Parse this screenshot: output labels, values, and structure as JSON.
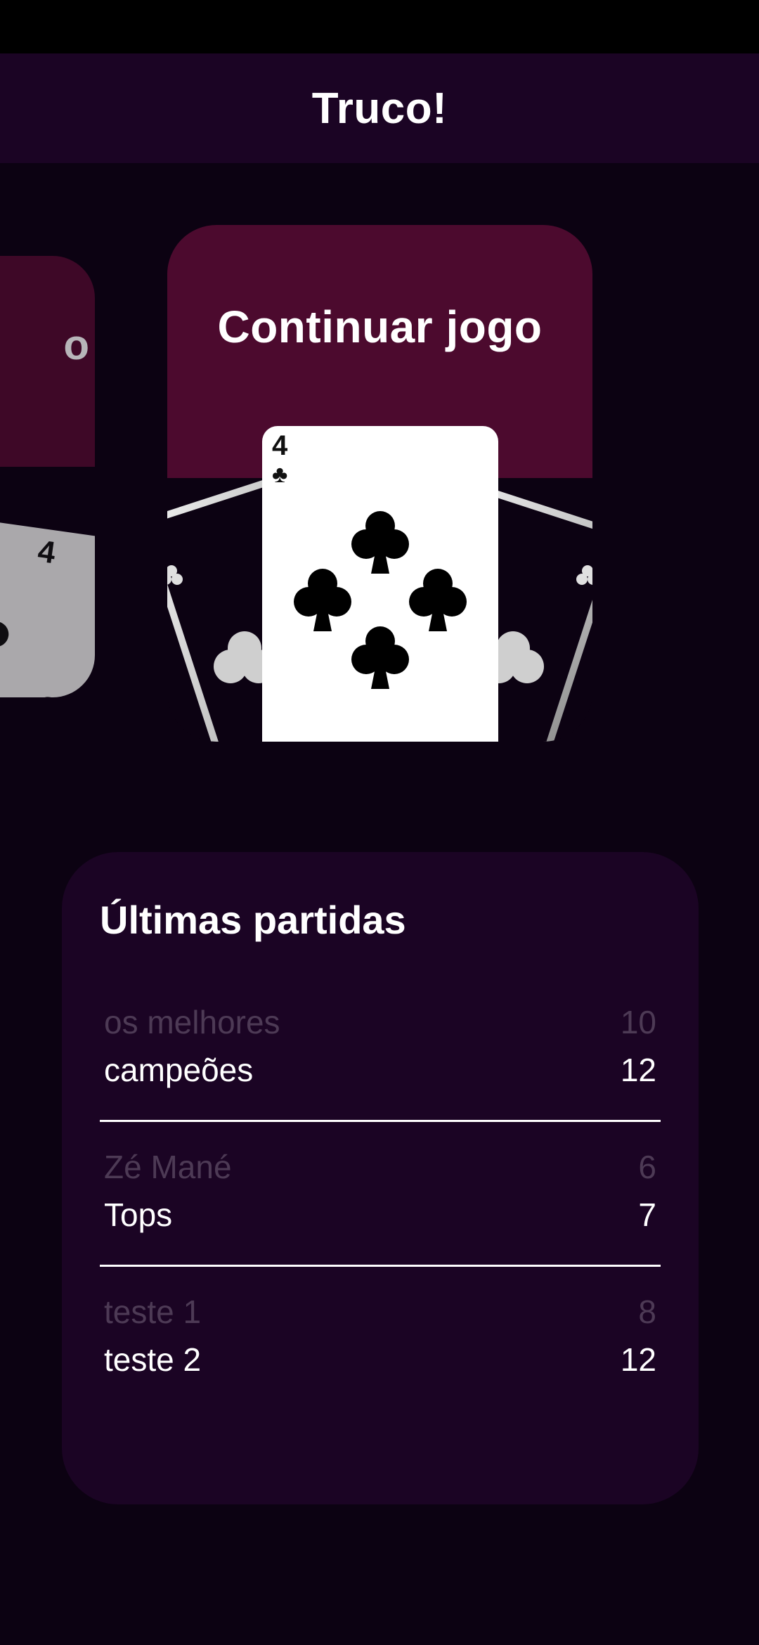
{
  "app": {
    "title": "Truco!"
  },
  "carousel": {
    "side_card": {
      "title_fragment": "o",
      "card_rank": "4"
    },
    "main_card": {
      "title": "Continuar jogo",
      "card_rank": "4",
      "card_suit": "♣"
    }
  },
  "recent": {
    "title": "Últimas partidas",
    "matches": [
      {
        "team_a": "os melhores",
        "score_a": "10",
        "team_b": "campeões",
        "score_b": "12"
      },
      {
        "team_a": "Zé Mané",
        "score_a": "6",
        "team_b": "Tops",
        "score_b": "7"
      },
      {
        "team_a": "teste 1",
        "score_a": "8",
        "team_b": "teste 2",
        "score_b": "12"
      }
    ]
  },
  "colors": {
    "background": "#0c0212",
    "app_bar": "#1b0424",
    "card_header": "#4c0a2e",
    "panel": "#1b0424",
    "muted_text": "#4d3a55"
  },
  "icons": {
    "suit": "clubs-icon"
  }
}
